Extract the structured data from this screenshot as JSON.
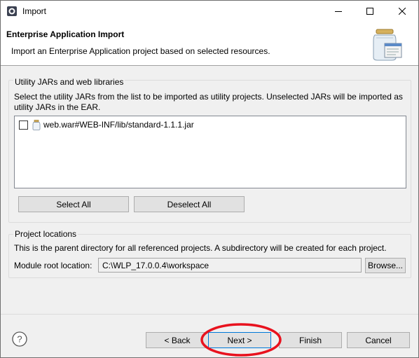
{
  "window": {
    "title": "Import"
  },
  "banner": {
    "title": "Enterprise Application Import",
    "description": "Import an Enterprise Application project based on selected resources."
  },
  "utility_group": {
    "title": "Utility JARs and web libraries",
    "description": "Select the utility JARs from the list to be imported as utility projects. Unselected JARs will be imported as utility JARs in the EAR.",
    "items": [
      {
        "label": "web.war#WEB-INF/lib/standard-1.1.1.jar",
        "checked": false
      }
    ],
    "select_all_label": "Select All",
    "deselect_all_label": "Deselect All"
  },
  "project_locations": {
    "title": "Project locations",
    "description": "This is the parent directory for all referenced projects. A subdirectory will be created for each project.",
    "module_root_label": "Module root location:",
    "module_root_value": "C:\\WLP_17.0.0.4\\workspace",
    "browse_label": "Browse..."
  },
  "footer": {
    "back_label": "< Back",
    "next_label": "Next >",
    "finish_label": "Finish",
    "cancel_label": "Cancel"
  },
  "colors": {
    "highlight": "#e8121e",
    "button_bg": "#e1e1e1",
    "window_bg": "#f0f0f0",
    "next_border": "#0078d7"
  },
  "icons": {
    "app": "eclipse-icon",
    "minimize": "minimize-icon",
    "maximize": "maximize-icon",
    "close": "close-icon",
    "banner": "jar-import-wizard-icon",
    "jar": "jar-icon",
    "help": "help-icon"
  }
}
